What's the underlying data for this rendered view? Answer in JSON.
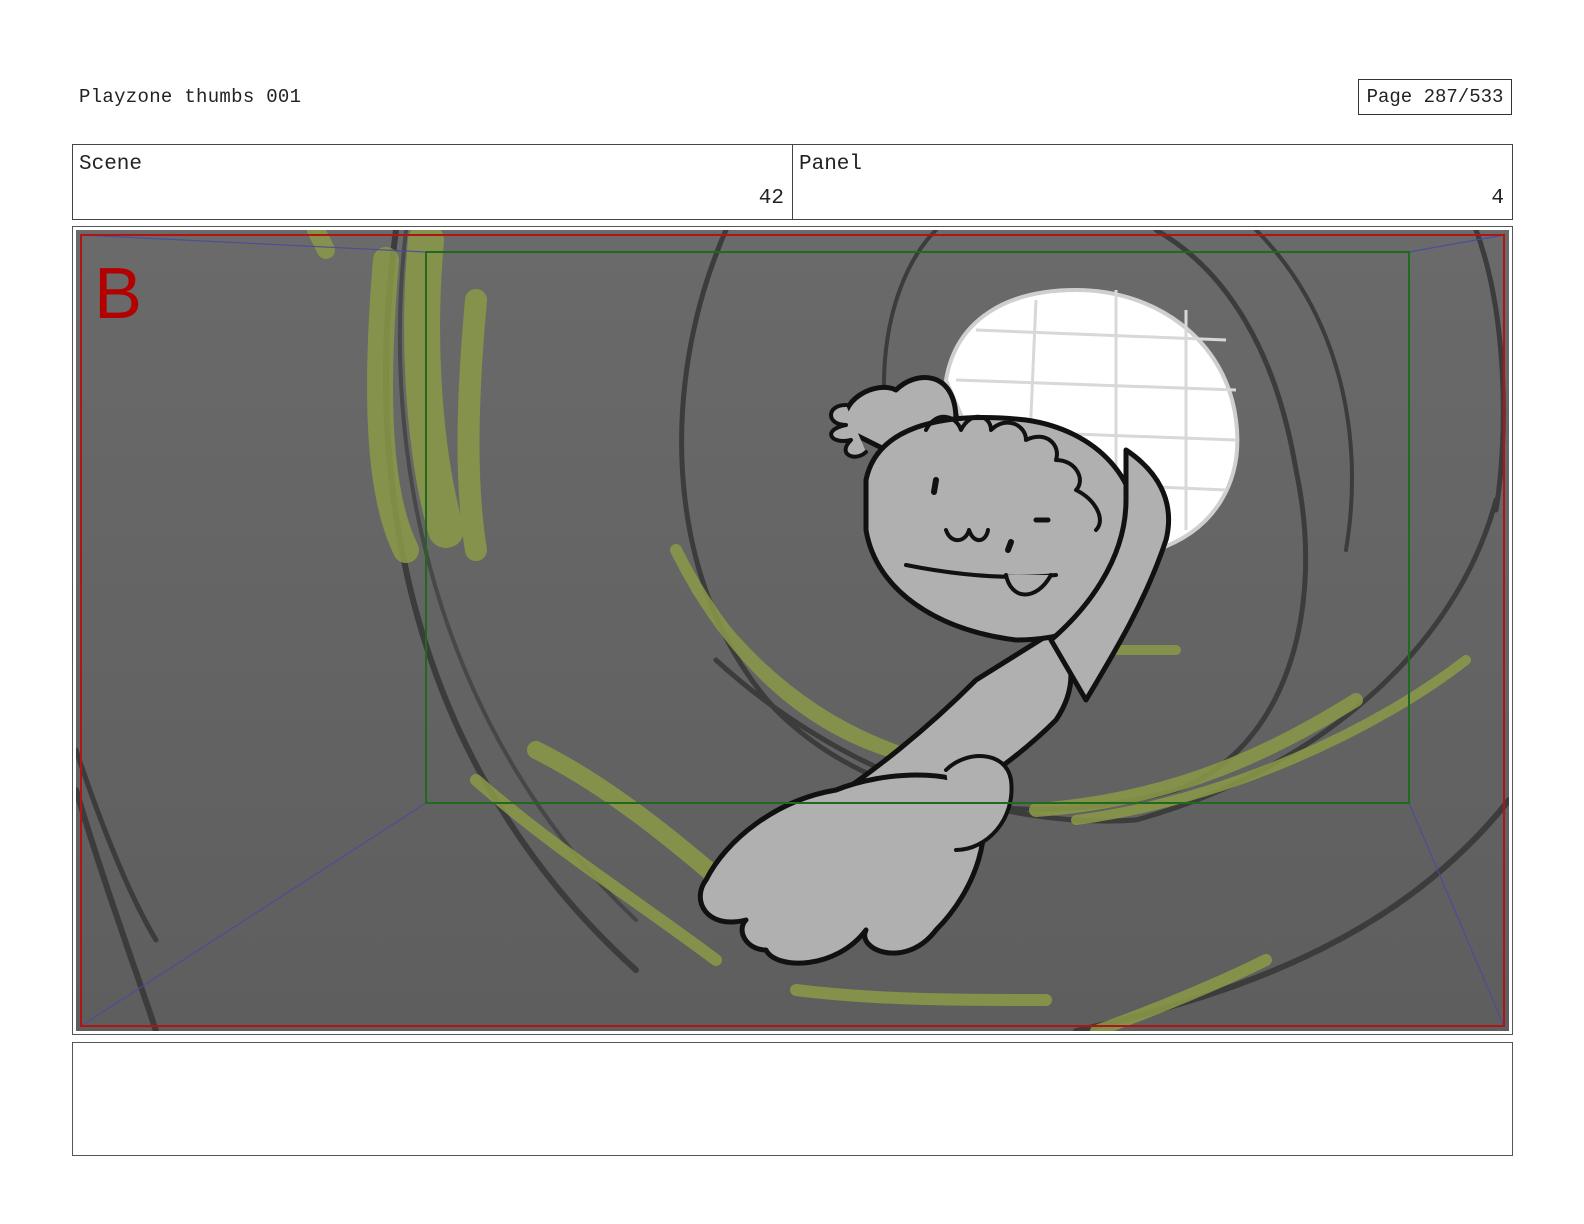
{
  "header": {
    "title": "Playzone thumbs 001",
    "page_label": "Page 287/533"
  },
  "info": {
    "scene_label": "Scene",
    "scene_value": "42",
    "panel_label": "Panel",
    "panel_value": "4"
  },
  "frame": {
    "marker": "B",
    "colors": {
      "background": "#676767",
      "swirl": "#3c3c3c",
      "motion_streak": "#8a9a48",
      "figure_fill": "#b0b0b0",
      "outline": "#111111",
      "opening": "#ffffff",
      "safe_area": "#1e6b1e",
      "frame_border": "#b01515",
      "perspective_guides": "#4a4aa0",
      "marker": "#b30000"
    }
  },
  "notes": {
    "text": ""
  }
}
